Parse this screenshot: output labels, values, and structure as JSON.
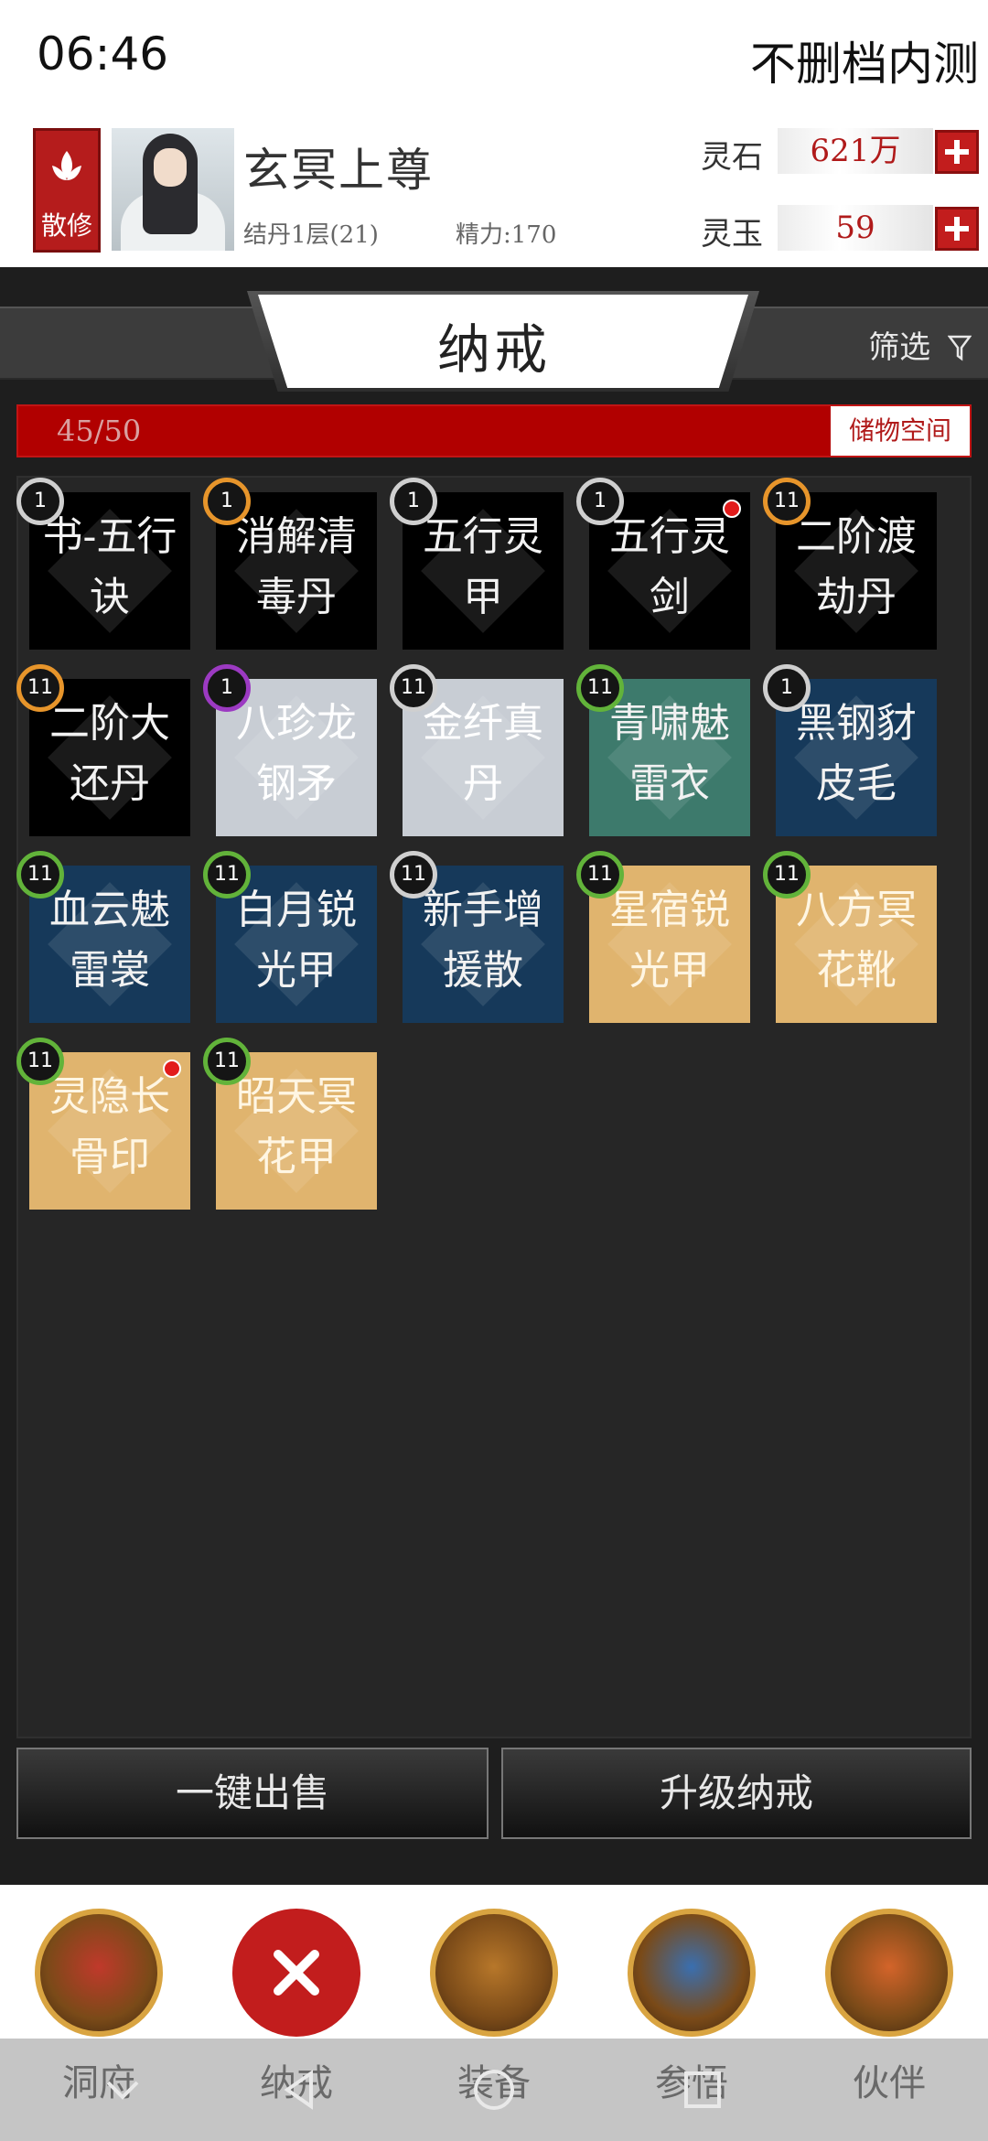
{
  "status": {
    "time": "06:46",
    "server": "不删档内测"
  },
  "player": {
    "sect": "散修",
    "name": "玄冥上尊",
    "realm": "结丹1层(21)",
    "stamina": "精力:170"
  },
  "currency": [
    {
      "label": "灵石",
      "value": "621万"
    },
    {
      "label": "灵玉",
      "value": "59"
    }
  ],
  "panel": {
    "title": "纳戒",
    "filter_label": "筛选",
    "capacity_text": "45/50",
    "capacity_fraction": 0.9,
    "capacity_label": "储物空间"
  },
  "items": [
    {
      "name1": "书-五行",
      "name2": "诀",
      "level": "1",
      "bg": "#000000",
      "ring": "#cfcfcf",
      "dot": false,
      "q": ""
    },
    {
      "name1": "消解清",
      "name2": "毒丹",
      "level": "1",
      "bg": "#000000",
      "ring": "#e7952b",
      "dot": false,
      "q": ""
    },
    {
      "name1": "五行灵",
      "name2": "甲",
      "level": "1",
      "bg": "#000000",
      "ring": "#cfcfcf",
      "dot": false,
      "q": ""
    },
    {
      "name1": "五行灵",
      "name2": "剑",
      "level": "1",
      "bg": "#000000",
      "ring": "#cfcfcf",
      "dot": true,
      "q": ""
    },
    {
      "name1": "二阶渡",
      "name2": "劫丹",
      "level": "11",
      "bg": "#000000",
      "ring": "#e7952b",
      "dot": false,
      "q": ""
    },
    {
      "name1": "二阶大",
      "name2": "还丹",
      "level": "11",
      "bg": "#000000",
      "ring": "#e7952b",
      "dot": false,
      "q": ""
    },
    {
      "name1": "八珍龙",
      "name2": "钢矛",
      "level": "1",
      "bg": "#c8cdd4",
      "ring": "#9c3ac2",
      "dot": false,
      "q": "light"
    },
    {
      "name1": "金纤真",
      "name2": "丹",
      "level": "11",
      "bg": "#c8cdd4",
      "ring": "#cfcfcf",
      "dot": false,
      "q": "light"
    },
    {
      "name1": "青啸魅",
      "name2": "雷衣",
      "level": "11",
      "bg": "#3d7a6c",
      "ring": "#62b33a",
      "dot": false,
      "q": ""
    },
    {
      "name1": "黑钢豺",
      "name2": "皮毛",
      "level": "1",
      "bg": "#16395a",
      "ring": "#cfcfcf",
      "dot": false,
      "q": ""
    },
    {
      "name1": "血云魅",
      "name2": "雷裳",
      "level": "11",
      "bg": "#16395a",
      "ring": "#62b33a",
      "dot": false,
      "q": ""
    },
    {
      "name1": "白月锐",
      "name2": "光甲",
      "level": "11",
      "bg": "#16395a",
      "ring": "#62b33a",
      "dot": false,
      "q": ""
    },
    {
      "name1": "新手增",
      "name2": "援散",
      "level": "11",
      "bg": "#16395a",
      "ring": "#cfcfcf",
      "dot": false,
      "q": ""
    },
    {
      "name1": "星宿锐",
      "name2": "光甲",
      "level": "11",
      "bg": "#e0b46e",
      "ring": "#62b33a",
      "dot": false,
      "q": "gold"
    },
    {
      "name1": "八方冥",
      "name2": "花靴",
      "level": "11",
      "bg": "#e0b46e",
      "ring": "#62b33a",
      "dot": false,
      "q": "gold"
    },
    {
      "name1": "灵隐长",
      "name2": "骨印",
      "level": "11",
      "bg": "#e0b46e",
      "ring": "#62b33a",
      "dot": true,
      "q": "gold"
    },
    {
      "name1": "昭天冥",
      "name2": "花甲",
      "level": "11",
      "bg": "#e0b46e",
      "ring": "#62b33a",
      "dot": false,
      "q": "gold"
    }
  ],
  "actions": {
    "sell_all": "一键出售",
    "upgrade": "升级纳戒"
  },
  "nav": [
    {
      "label": "洞府",
      "icon": "mansion-icon",
      "color": "#c0392b"
    },
    {
      "label": "纳戒",
      "icon": "close-icon",
      "color": "#c21d1d"
    },
    {
      "label": "装备",
      "icon": "helmet-icon",
      "color": "#b7772a"
    },
    {
      "label": "参悟",
      "icon": "scroll-icon",
      "color": "#3a6fb0"
    },
    {
      "label": "伙伴",
      "icon": "partner-icon",
      "color": "#d3642a"
    }
  ]
}
